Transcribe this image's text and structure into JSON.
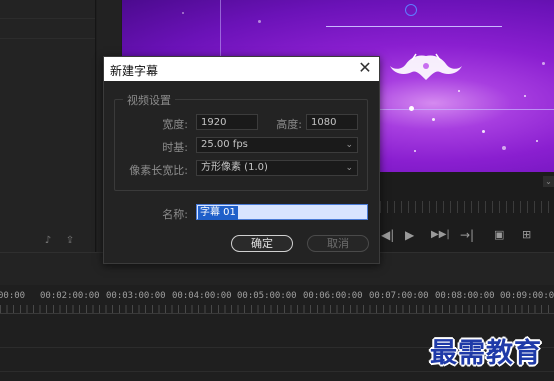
{
  "dialog": {
    "title": "新建字幕",
    "close_label": "✕",
    "group_title": "视频设置",
    "width_label": "宽度:",
    "width_value": "1920",
    "height_label": "高度:",
    "height_value": "1080",
    "timebase_label": "时基:",
    "timebase_value": "25.00 fps",
    "pixel_aspect_label": "像素长宽比:",
    "pixel_aspect_value": "方形像素 (1.0)",
    "name_label": "名称:",
    "name_value": "字幕 01",
    "ok_label": "确定",
    "cancel_label": "取消"
  },
  "timeline": {
    "ticks": [
      "00:00",
      "00:02:00:00",
      "00:03:00:00",
      "00:04:00:00",
      "00:05:00:00",
      "00:06:00:00",
      "00:07:00:00",
      "00:08:00:00",
      "00:09:00:00"
    ]
  },
  "watermark": "最需教育",
  "icons": {
    "play": "▶",
    "step_forward": "▶▶|",
    "step_back": "◀|",
    "fast_forward": "→|",
    "export_frame": "export-frame-icon",
    "compare": "compare-icon",
    "chevron": "⌄"
  },
  "colors": {
    "preview_purple": "#8a1fd0",
    "selection_blue": "#1f5fc9",
    "watermark_blue": "#1f3aa8"
  }
}
